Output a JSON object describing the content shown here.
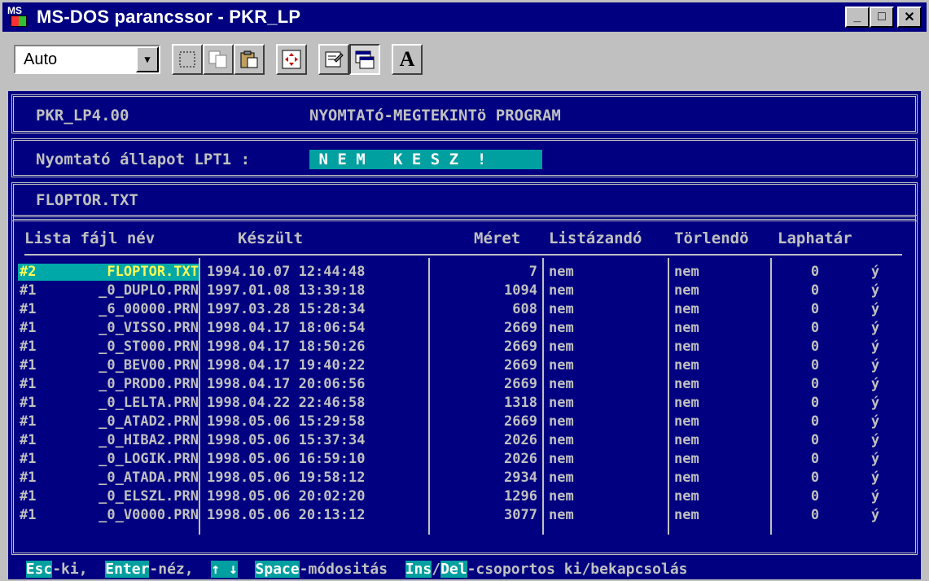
{
  "window": {
    "title": "MS-DOS parancssor - PKR_LP",
    "controls": {
      "minimize": "_",
      "maximize": "□",
      "close": "✕"
    }
  },
  "toolbar": {
    "font_size": "Auto",
    "tools": [
      "mark-icon",
      "copy-icon",
      "paste-icon",
      "fullscreen-icon",
      "properties-icon",
      "background-icon",
      "font-icon"
    ],
    "font_tool_label": "A"
  },
  "header": {
    "program_version": "PKR_LP4.00",
    "program_title": "NYOMTATó-MEGTEKINTö PROGRAM",
    "printer_status_label": "Nyomtató állapot LPT1 :",
    "printer_status_value": " N E M   K E S Z  ! ",
    "current_file": "FLOPTOR.TXT"
  },
  "table": {
    "columns": [
      "Lista fájl név",
      "Készült",
      "Méret",
      "Listázandó",
      "Törlendö",
      "Laphatár"
    ],
    "rows": [
      {
        "mark": "#2",
        "name": "FLOPTOR.TXT",
        "date": "1994.10.07 12:44:48",
        "size": "7",
        "list": "nem",
        "delete": "nem",
        "page": "0",
        "flag": "ý"
      },
      {
        "mark": "#1",
        "name": "_0_DUPLO.PRN",
        "date": "1997.01.08 13:39:18",
        "size": "1094",
        "list": "nem",
        "delete": "nem",
        "page": "0",
        "flag": "ý"
      },
      {
        "mark": "#1",
        "name": "_6_00000.PRN",
        "date": "1997.03.28 15:28:34",
        "size": "608",
        "list": "nem",
        "delete": "nem",
        "page": "0",
        "flag": "ý"
      },
      {
        "mark": "#1",
        "name": "_0_VISSO.PRN",
        "date": "1998.04.17 18:06:54",
        "size": "2669",
        "list": "nem",
        "delete": "nem",
        "page": "0",
        "flag": "ý"
      },
      {
        "mark": "#1",
        "name": "_0_ST000.PRN",
        "date": "1998.04.17 18:50:26",
        "size": "2669",
        "list": "nem",
        "delete": "nem",
        "page": "0",
        "flag": "ý"
      },
      {
        "mark": "#1",
        "name": "_0_BEV00.PRN",
        "date": "1998.04.17 19:40:22",
        "size": "2669",
        "list": "nem",
        "delete": "nem",
        "page": "0",
        "flag": "ý"
      },
      {
        "mark": "#1",
        "name": "_0_PROD0.PRN",
        "date": "1998.04.17 20:06:56",
        "size": "2669",
        "list": "nem",
        "delete": "nem",
        "page": "0",
        "flag": "ý"
      },
      {
        "mark": "#1",
        "name": "_0_LELTA.PRN",
        "date": "1998.04.22 22:46:58",
        "size": "1318",
        "list": "nem",
        "delete": "nem",
        "page": "0",
        "flag": "ý"
      },
      {
        "mark": "#1",
        "name": "_0_ATAD2.PRN",
        "date": "1998.05.06 15:29:58",
        "size": "2669",
        "list": "nem",
        "delete": "nem",
        "page": "0",
        "flag": "ý"
      },
      {
        "mark": "#1",
        "name": "_0_HIBA2.PRN",
        "date": "1998.05.06 15:37:34",
        "size": "2026",
        "list": "nem",
        "delete": "nem",
        "page": "0",
        "flag": "ý"
      },
      {
        "mark": "#1",
        "name": "_0_LOGIK.PRN",
        "date": "1998.05.06 16:59:10",
        "size": "2026",
        "list": "nem",
        "delete": "nem",
        "page": "0",
        "flag": "ý"
      },
      {
        "mark": "#1",
        "name": "_0_ATADA.PRN",
        "date": "1998.05.06 19:58:12",
        "size": "2934",
        "list": "nem",
        "delete": "nem",
        "page": "0",
        "flag": "ý"
      },
      {
        "mark": "#1",
        "name": "_0_ELSZL.PRN",
        "date": "1998.05.06 20:02:20",
        "size": "1296",
        "list": "nem",
        "delete": "nem",
        "page": "0",
        "flag": "ý"
      },
      {
        "mark": "#1",
        "name": "_0_V0000.PRN",
        "date": "1998.05.06 20:13:12",
        "size": "3077",
        "list": "nem",
        "delete": "nem",
        "page": "0",
        "flag": "ý"
      }
    ]
  },
  "footer": {
    "items": [
      {
        "key": "Esc",
        "text": "-ki,  "
      },
      {
        "key": "Enter",
        "text": "-néz,  "
      },
      {
        "key": "↑ ↓",
        "text": "  "
      },
      {
        "key": "Space",
        "text": "-módositás  "
      },
      {
        "key": "Ins",
        "text": "/"
      },
      {
        "key": "Del",
        "text": "-csoportos ki/bekapcsolás"
      }
    ]
  },
  "colors": {
    "console_bg": "#000080",
    "console_fg": "#c0c0c0",
    "highlight": "#00a0a0",
    "selected_fg": "#ffff55"
  }
}
